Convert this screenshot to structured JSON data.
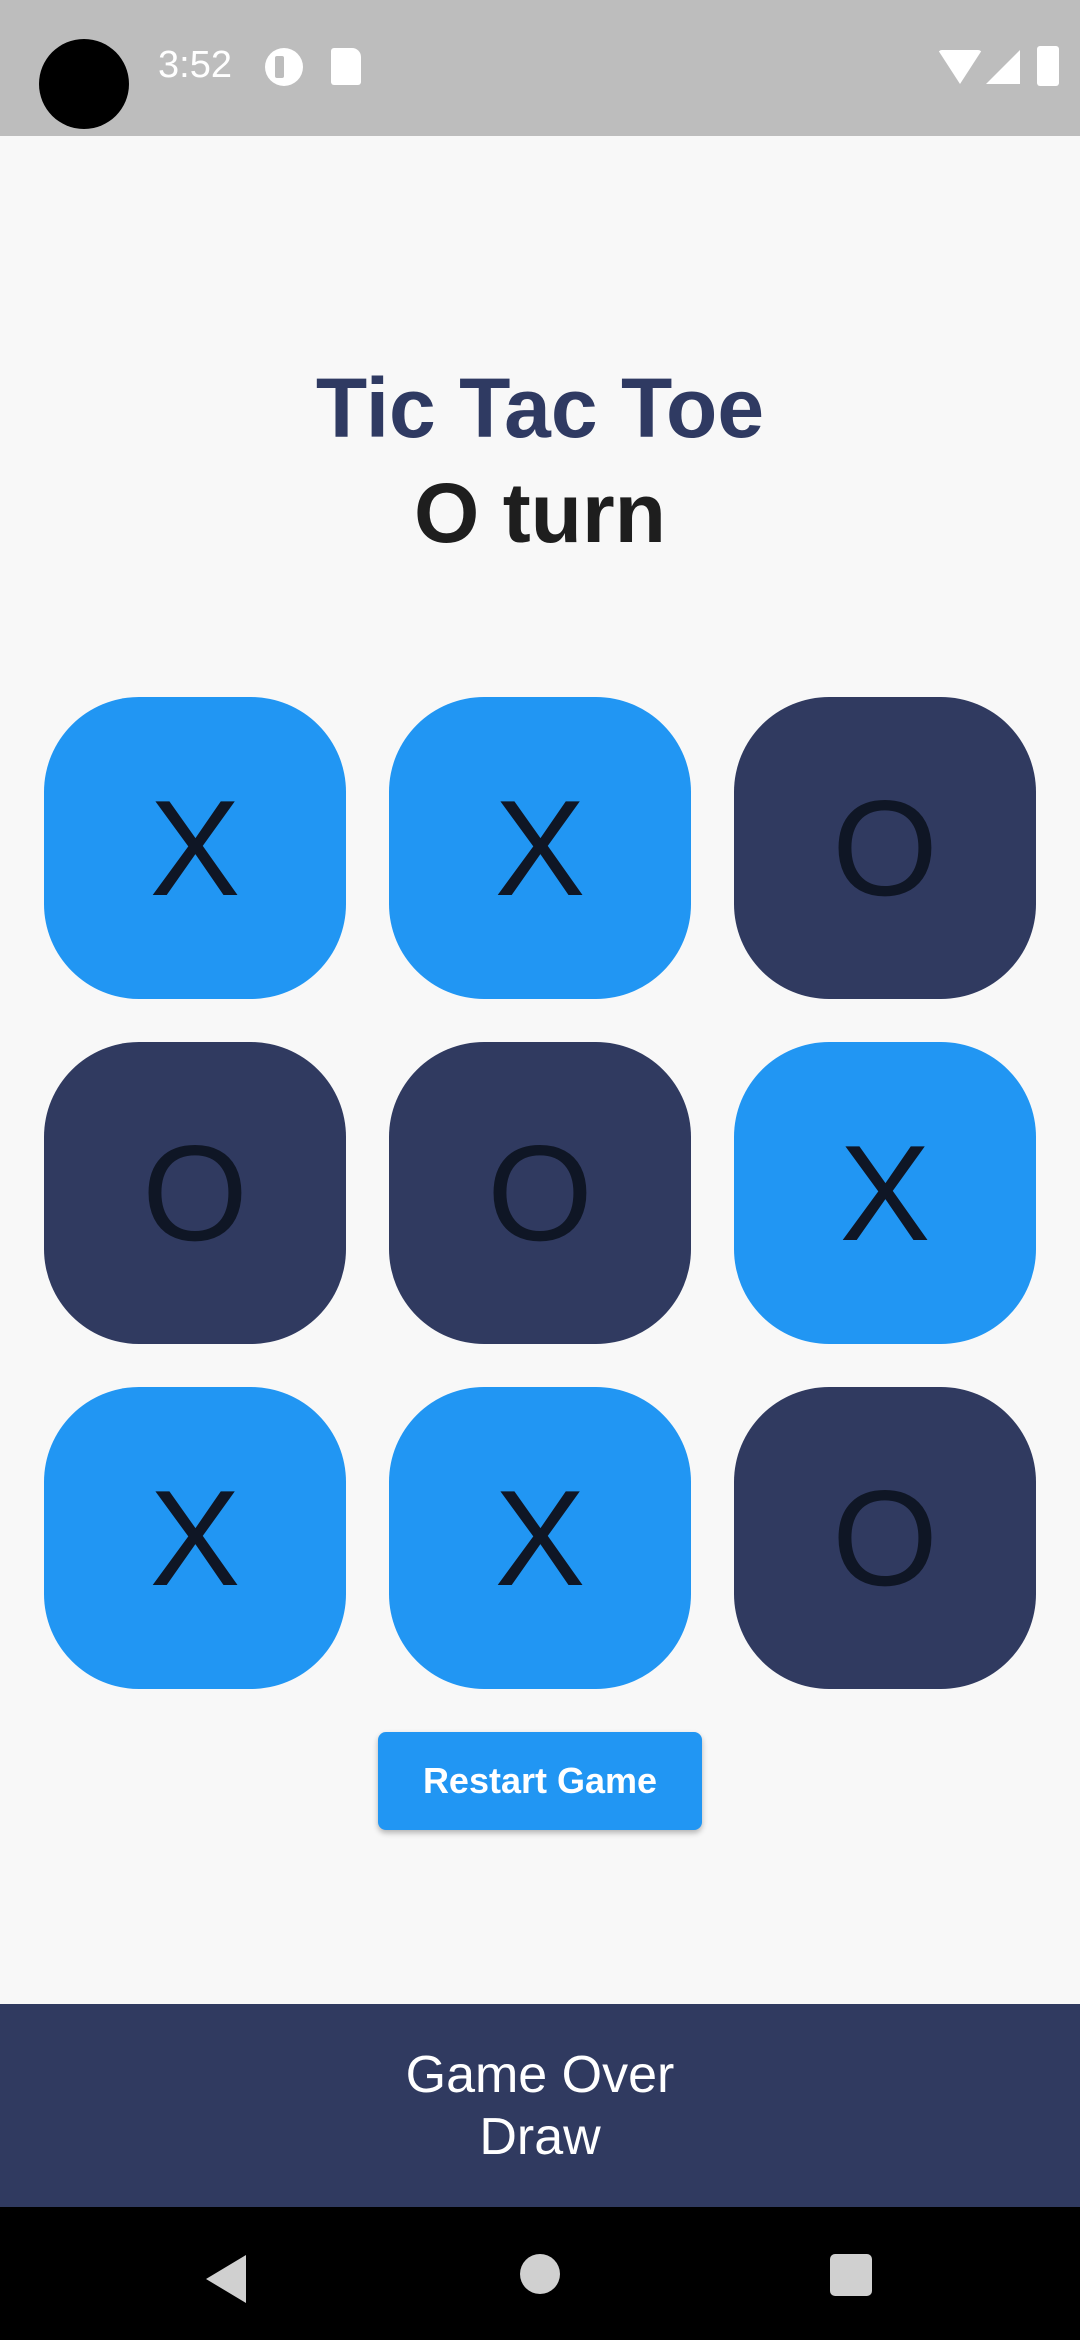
{
  "status_bar": {
    "time": "3:52"
  },
  "header": {
    "title": "Tic Tac Toe",
    "turn": "O turn"
  },
  "board": {
    "cells": [
      "X",
      "X",
      "O",
      "O",
      "O",
      "X",
      "X",
      "X",
      "O"
    ]
  },
  "controls": {
    "restart_label": "Restart Game"
  },
  "result": {
    "line1": "Game Over",
    "line2": "Draw"
  },
  "colors": {
    "x_tile": "#2196f3",
    "o_tile": "#303a60",
    "title": "#2f3a62",
    "background": "#f8f8f8"
  },
  "icons": {
    "status_left": [
      "app-notification-icon",
      "sd-card-icon"
    ],
    "status_right": [
      "wifi-icon",
      "signal-icon",
      "battery-icon"
    ],
    "nav": [
      "back-icon",
      "home-icon",
      "recents-icon"
    ]
  }
}
